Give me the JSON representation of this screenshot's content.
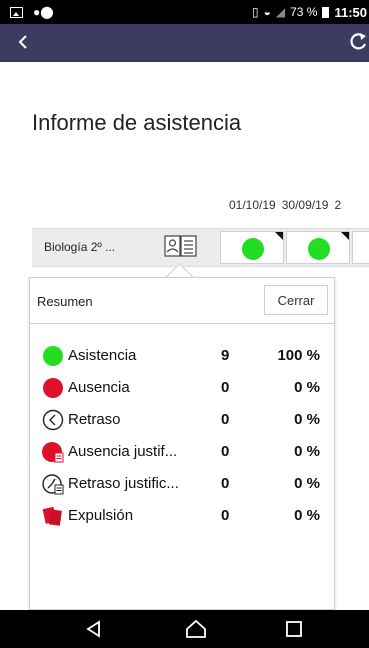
{
  "status_bar": {
    "battery": "73 %",
    "time": "11:50"
  },
  "app_bar": {
    "back_icon": "chevron-left-icon",
    "refresh_icon": "refresh-icon",
    "color": "#3e3b63"
  },
  "page": {
    "title": "Informe de asistencia"
  },
  "dates": [
    "01/10/19",
    "30/09/19",
    "2"
  ],
  "student": {
    "name": "Biología 2º ...",
    "report_icon": "student-report-icon",
    "cells": [
      {
        "status": "present",
        "color": "#22dd22"
      },
      {
        "status": "present",
        "color": "#22dd22"
      }
    ]
  },
  "summary": {
    "title": "Resumen",
    "close_label": "Cerrar",
    "rows": [
      {
        "icon": "green-dot-icon",
        "label": "Asistencia",
        "count": "9",
        "percent": "100 %"
      },
      {
        "icon": "red-dot-icon",
        "label": "Ausencia",
        "count": "0",
        "percent": "0 %"
      },
      {
        "icon": "clock-left-icon",
        "label": "Retraso",
        "count": "0",
        "percent": "0 %"
      },
      {
        "icon": "red-dot-document-icon",
        "label": "Ausencia justif...",
        "count": "0",
        "percent": "0 %"
      },
      {
        "icon": "clock-document-icon",
        "label": "Retraso justific...",
        "count": "0",
        "percent": "0 %"
      },
      {
        "icon": "red-cards-icon",
        "label": "Expulsión",
        "count": "0",
        "percent": "0 %"
      }
    ]
  },
  "nav_bar": {
    "back": "nav-back-icon",
    "home": "nav-home-icon",
    "recents": "nav-recents-icon"
  }
}
